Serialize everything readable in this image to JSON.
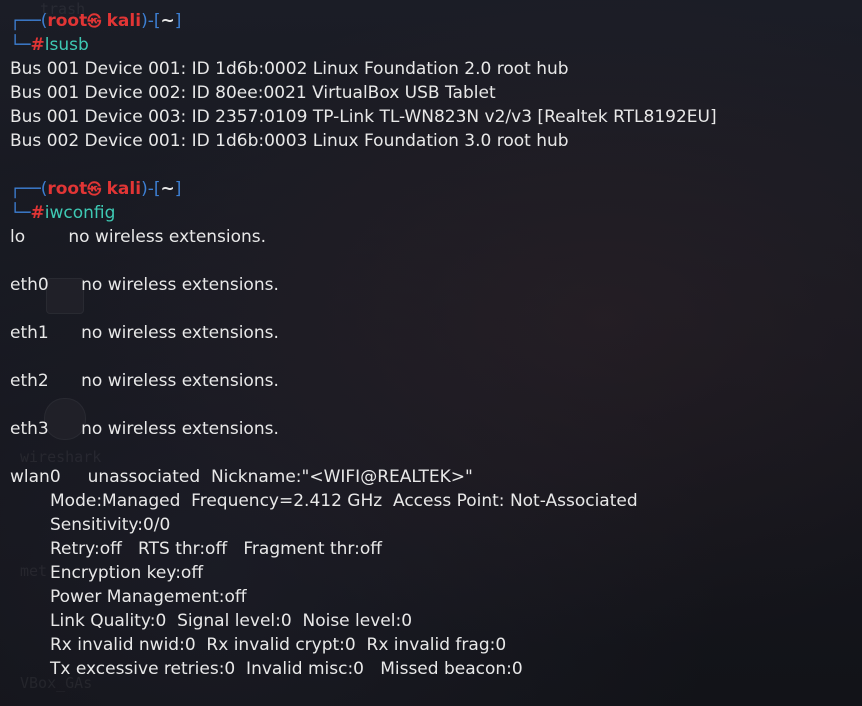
{
  "background_hints": {
    "labels": [
      "trash",
      "wireshark",
      "met",
      "VBox_GAs"
    ]
  },
  "prompt": {
    "user": "root",
    "at_symbol": "㉿",
    "host": "kali",
    "cwd": "~",
    "frame_top": "┌──(",
    "frame_mid": ")-[",
    "frame_end": "]",
    "frame_bottom": "└─",
    "hash": "#"
  },
  "session": {
    "cmd1": "lsusb",
    "lsusb_output": [
      "Bus 001 Device 001: ID 1d6b:0002 Linux Foundation 2.0 root hub",
      "Bus 001 Device 002: ID 80ee:0021 VirtualBox USB Tablet",
      "Bus 001 Device 003: ID 2357:0109 TP-Link TL-WN823N v2/v3 [Realtek RTL8192EU]",
      "Bus 002 Device 001: ID 1d6b:0003 Linux Foundation 3.0 root hub"
    ],
    "cmd2": "iwconfig",
    "iwconfig": {
      "lo": "lo        no wireless extensions.",
      "eth0": "eth0      no wireless extensions.",
      "eth1": "eth1      no wireless extensions.",
      "eth2": "eth2      no wireless extensions.",
      "eth3": "eth3      no wireless extensions.",
      "wlan0_header": "wlan0     unassociated  Nickname:\"<WIFI@REALTEK>\"",
      "wlan0_details": [
        "Mode:Managed  Frequency=2.412 GHz  Access Point: Not-Associated",
        "Sensitivity:0/0",
        "Retry:off   RTS thr:off   Fragment thr:off",
        "Encryption key:off",
        "Power Management:off",
        "Link Quality:0  Signal level:0  Noise level:0",
        "Rx invalid nwid:0  Rx invalid crypt:0  Rx invalid frag:0",
        "Tx excessive retries:0  Invalid misc:0   Missed beacon:0"
      ]
    }
  },
  "colors": {
    "prompt_frame": "#3d7fd3",
    "prompt_user": "#e13535",
    "command": "#3ec9b4",
    "output": "#e8e8e8",
    "background": "#161821"
  }
}
